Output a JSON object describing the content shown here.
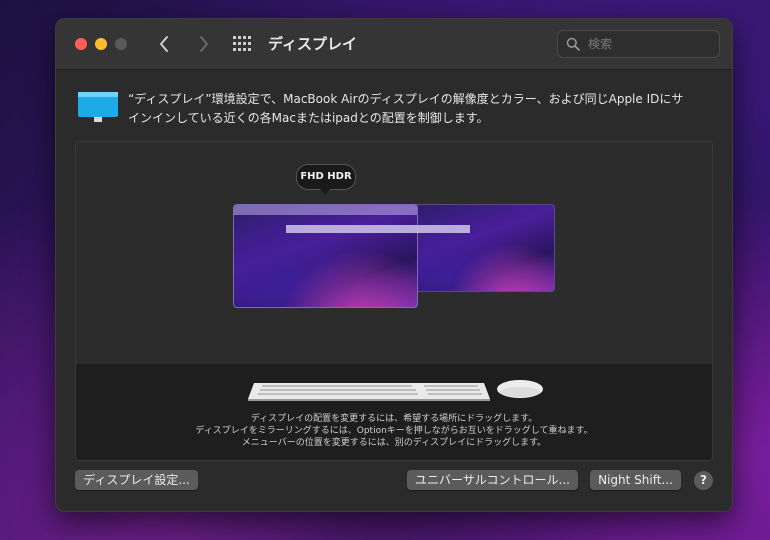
{
  "window": {
    "title": "ディスプレイ",
    "search_placeholder": "検索",
    "traffic_lights": {
      "close": "#ff5f57",
      "minimize": "#febc2e",
      "zoom": "#5a5a5a"
    },
    "nav": {
      "back_icon": "chevron-left-icon",
      "forward_icon": "chevron-right-icon",
      "grid_icon": "grid-icon"
    }
  },
  "description": {
    "line1": "“ディスプレイ”環境設定で、MacBook Airのディスプレイの解像度とカラー、および同じApple IDにサ",
    "line2": "インインしている近くの各Macまたはipadとの配置を制御します。"
  },
  "arrangement": {
    "display_badge": "FHD HDR",
    "hints": [
      "ディスプレイの配置を変更するには、希望する場所にドラッグします。",
      "ディスプレイをミラーリングするには、Optionキーを押しながらお互いをドラッグして重ねます。",
      "メニューバーの位置を変更するには、別のディスプレイにドラッグします。"
    ]
  },
  "buttons": {
    "display_settings": "ディスプレイ設定...",
    "universal_control": "ユニバーサルコントロール...",
    "night_shift": "Night Shift...",
    "help": "?"
  },
  "colors": {
    "window_bg": "#2b2b2b",
    "button_bg": "#5b5b5b",
    "accent_display": "#4a1f9a"
  }
}
